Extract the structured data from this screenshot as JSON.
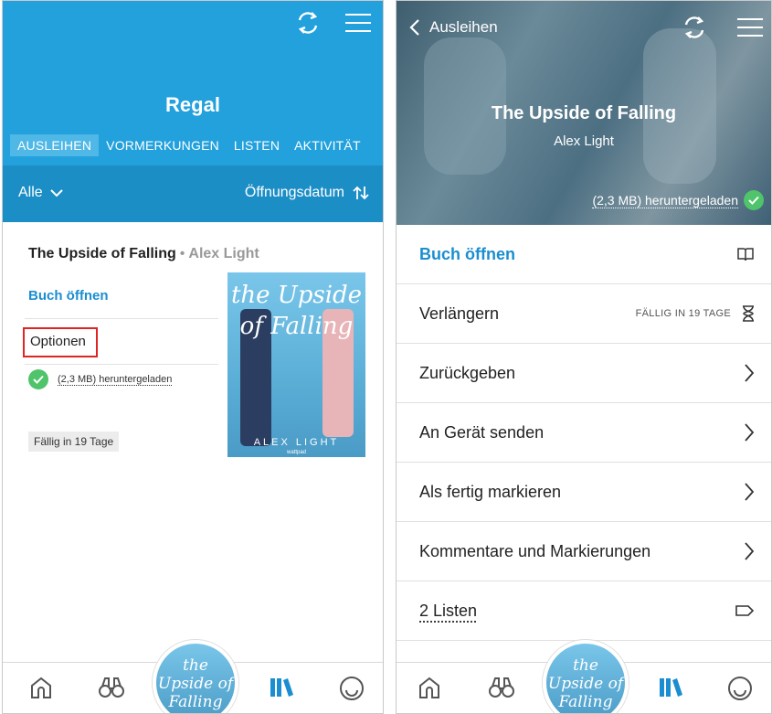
{
  "left": {
    "header": {
      "title": "Regal"
    },
    "tabs": [
      {
        "label": "AUSLEIHEN",
        "active": true
      },
      {
        "label": "VORMERKUNGEN",
        "active": false
      },
      {
        "label": "LISTEN",
        "active": false
      },
      {
        "label": "AKTIVITÄT",
        "active": false
      }
    ],
    "filter": {
      "left_label": "Alle",
      "sort_label": "Öffnungsdatum"
    },
    "book": {
      "title": "The Upside of Falling",
      "separator": "•",
      "author": "Alex Light",
      "open_label": "Buch öffnen",
      "options_label": "Optionen",
      "download_status": "(2,3 MB) heruntergeladen",
      "due_label": "Fällig in 19 Tage",
      "cover_title": "the Upside of Falling",
      "cover_author": "ALEX LIGHT",
      "cover_publisher": "wattpad"
    }
  },
  "right": {
    "header": {
      "back_label": "Ausleihen",
      "title": "The Upside of Falling",
      "author": "Alex Light",
      "download_status": "(2,3 MB) heruntergeladen"
    },
    "menu": [
      {
        "label": "Buch öffnen",
        "icon": "book-open-icon"
      },
      {
        "label": "Verlängern",
        "meta": "FÄLLIG IN 19 TAGE",
        "icon": "hourglass-icon"
      },
      {
        "label": "Zurückgeben",
        "icon": "chevron-right-icon"
      },
      {
        "label": "An Gerät senden",
        "icon": "chevron-right-icon"
      },
      {
        "label": "Als fertig markieren",
        "icon": "chevron-right-icon"
      },
      {
        "label": "Kommentare und Markierungen",
        "icon": "chevron-right-icon"
      },
      {
        "label": "2 Listen",
        "icon": "tag-icon"
      }
    ]
  },
  "nav": {
    "center_cover": "the Upside of Falling",
    "icons": [
      "home-icon",
      "binoculars-icon",
      "shelf-icon",
      "smiley-icon"
    ],
    "active_color": "#1a8ed0"
  },
  "colors": {
    "accent": "#22a1dd",
    "accent_dark": "#1c8ec6",
    "link": "#1a8ed0",
    "success": "#4fc46a",
    "highlight": "#e02424"
  }
}
